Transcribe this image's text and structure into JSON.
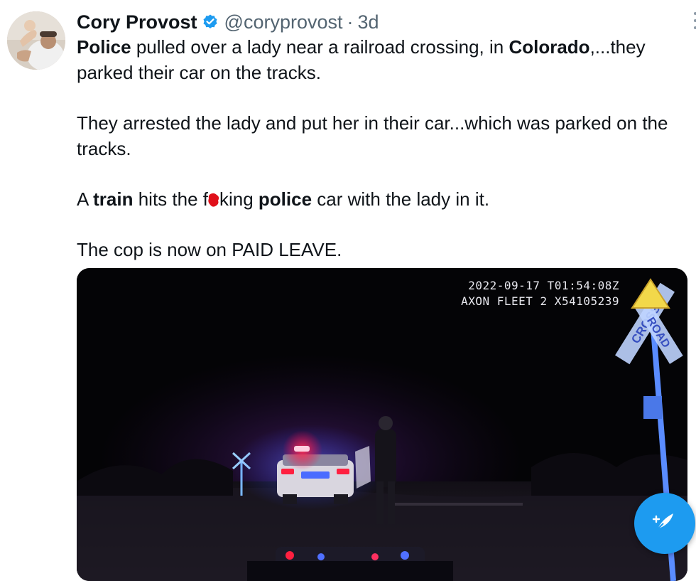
{
  "tweet": {
    "author_name": "Cory Provost",
    "handle": "@coryprovost",
    "separator": "·",
    "time": "3d",
    "lines": {
      "p1_a": "Police",
      "p1_b": " pulled over a lady near a railroad crossing, in ",
      "p1_c": "Colorado",
      "p1_d": ",...they parked their car on the tracks.",
      "p2": "They arrested the lady and put her in their car...which was parked on the tracks.",
      "p3_a": "A ",
      "p3_b": "train",
      "p3_c": " hits the f",
      "p3_d": "king ",
      "p3_e": "police",
      "p3_f": " car with the lady in it.",
      "p4": "The cop is now on PAID LEAVE."
    }
  },
  "video": {
    "timestamp": "2022-09-17 T01:54:08Z",
    "device": "AXON FLEET 2 X54105239",
    "sign_left": "CROSS",
    "sign_right": "ROAD"
  },
  "icons": {
    "verified": "verified-badge-icon",
    "more": "more-options-icon",
    "compose": "compose-tweet-icon",
    "censor_blot": "red-censor-blot-icon"
  },
  "colors": {
    "accent": "#1d9bf0",
    "text": "#0f1419",
    "secondary": "#536471"
  }
}
